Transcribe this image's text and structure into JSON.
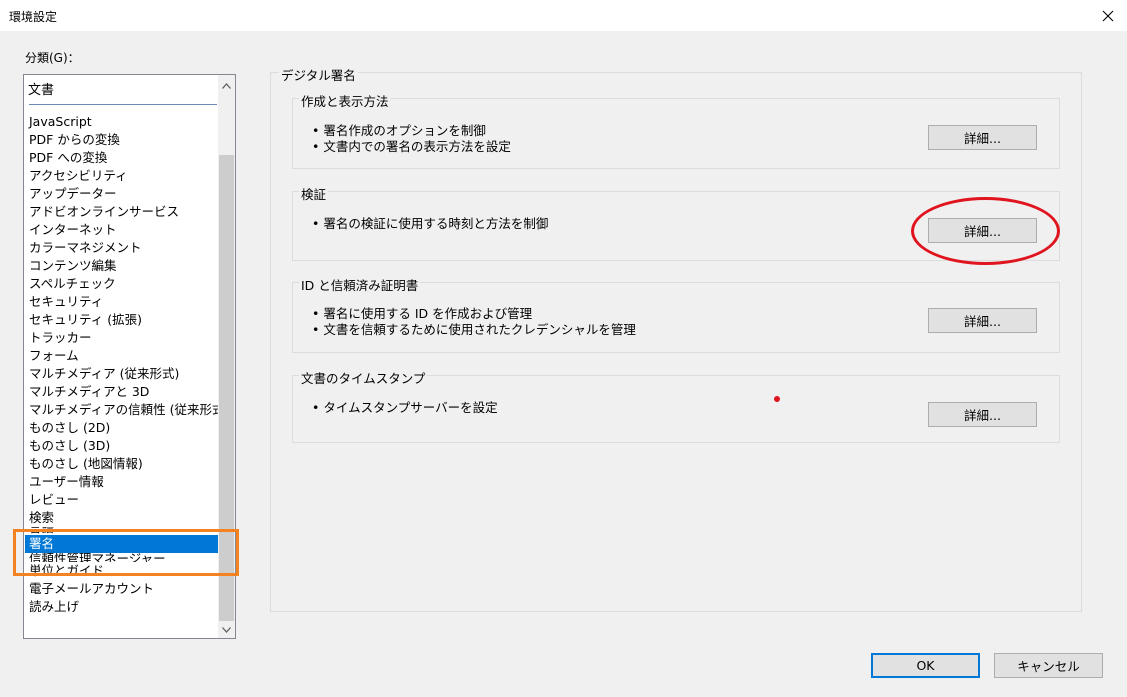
{
  "window": {
    "title": "環境設定"
  },
  "category": {
    "label": "分類(G)：",
    "header": "文書",
    "items": [
      "JavaScript",
      "PDF からの変換",
      "PDF への変換",
      "アクセシビリティ",
      "アップデーター",
      "アドビオンラインサービス",
      "インターネット",
      "カラーマネジメント",
      "コンテンツ編集",
      "スペルチェック",
      "セキュリティ",
      "セキュリティ (拡張)",
      "トラッカー",
      "フォーム",
      "マルチメディア (従来形式)",
      "マルチメディアと 3D",
      "マルチメディアの信頼性 (従来形式)",
      "ものさし (2D)",
      "ものさし (3D)",
      "ものさし (地図情報)",
      "ユーザー情報",
      "レビュー",
      "検索",
      "言語",
      "署名",
      "信頼性管理マネージャー",
      "単位とガイド",
      "電子メールアカウント",
      "読み上げ"
    ],
    "selected": "署名"
  },
  "main": {
    "title": "デジタル署名",
    "sections": [
      {
        "title": "作成と表示方法",
        "bullets": [
          "署名作成のオプションを制御",
          "文書内での署名の表示方法を設定"
        ],
        "button": "詳細..."
      },
      {
        "title": "検証",
        "bullets": [
          "署名の検証に使用する時刻と方法を制御"
        ],
        "button": "詳細..."
      },
      {
        "title": "ID と信頼済み証明書",
        "bullets": [
          "署名に使用する ID を作成および管理",
          "文書を信頼するために使用されたクレデンシャルを管理"
        ],
        "button": "詳細..."
      },
      {
        "title": "文書のタイムスタンプ",
        "bullets": [
          "タイムスタンプサーバーを設定"
        ],
        "button": "詳細..."
      }
    ]
  },
  "footer": {
    "ok": "OK",
    "cancel": "キャンセル"
  },
  "colors": {
    "selection": "#0078d7",
    "orange_highlight": "#f58220",
    "red_annotation": "#e0141e"
  }
}
